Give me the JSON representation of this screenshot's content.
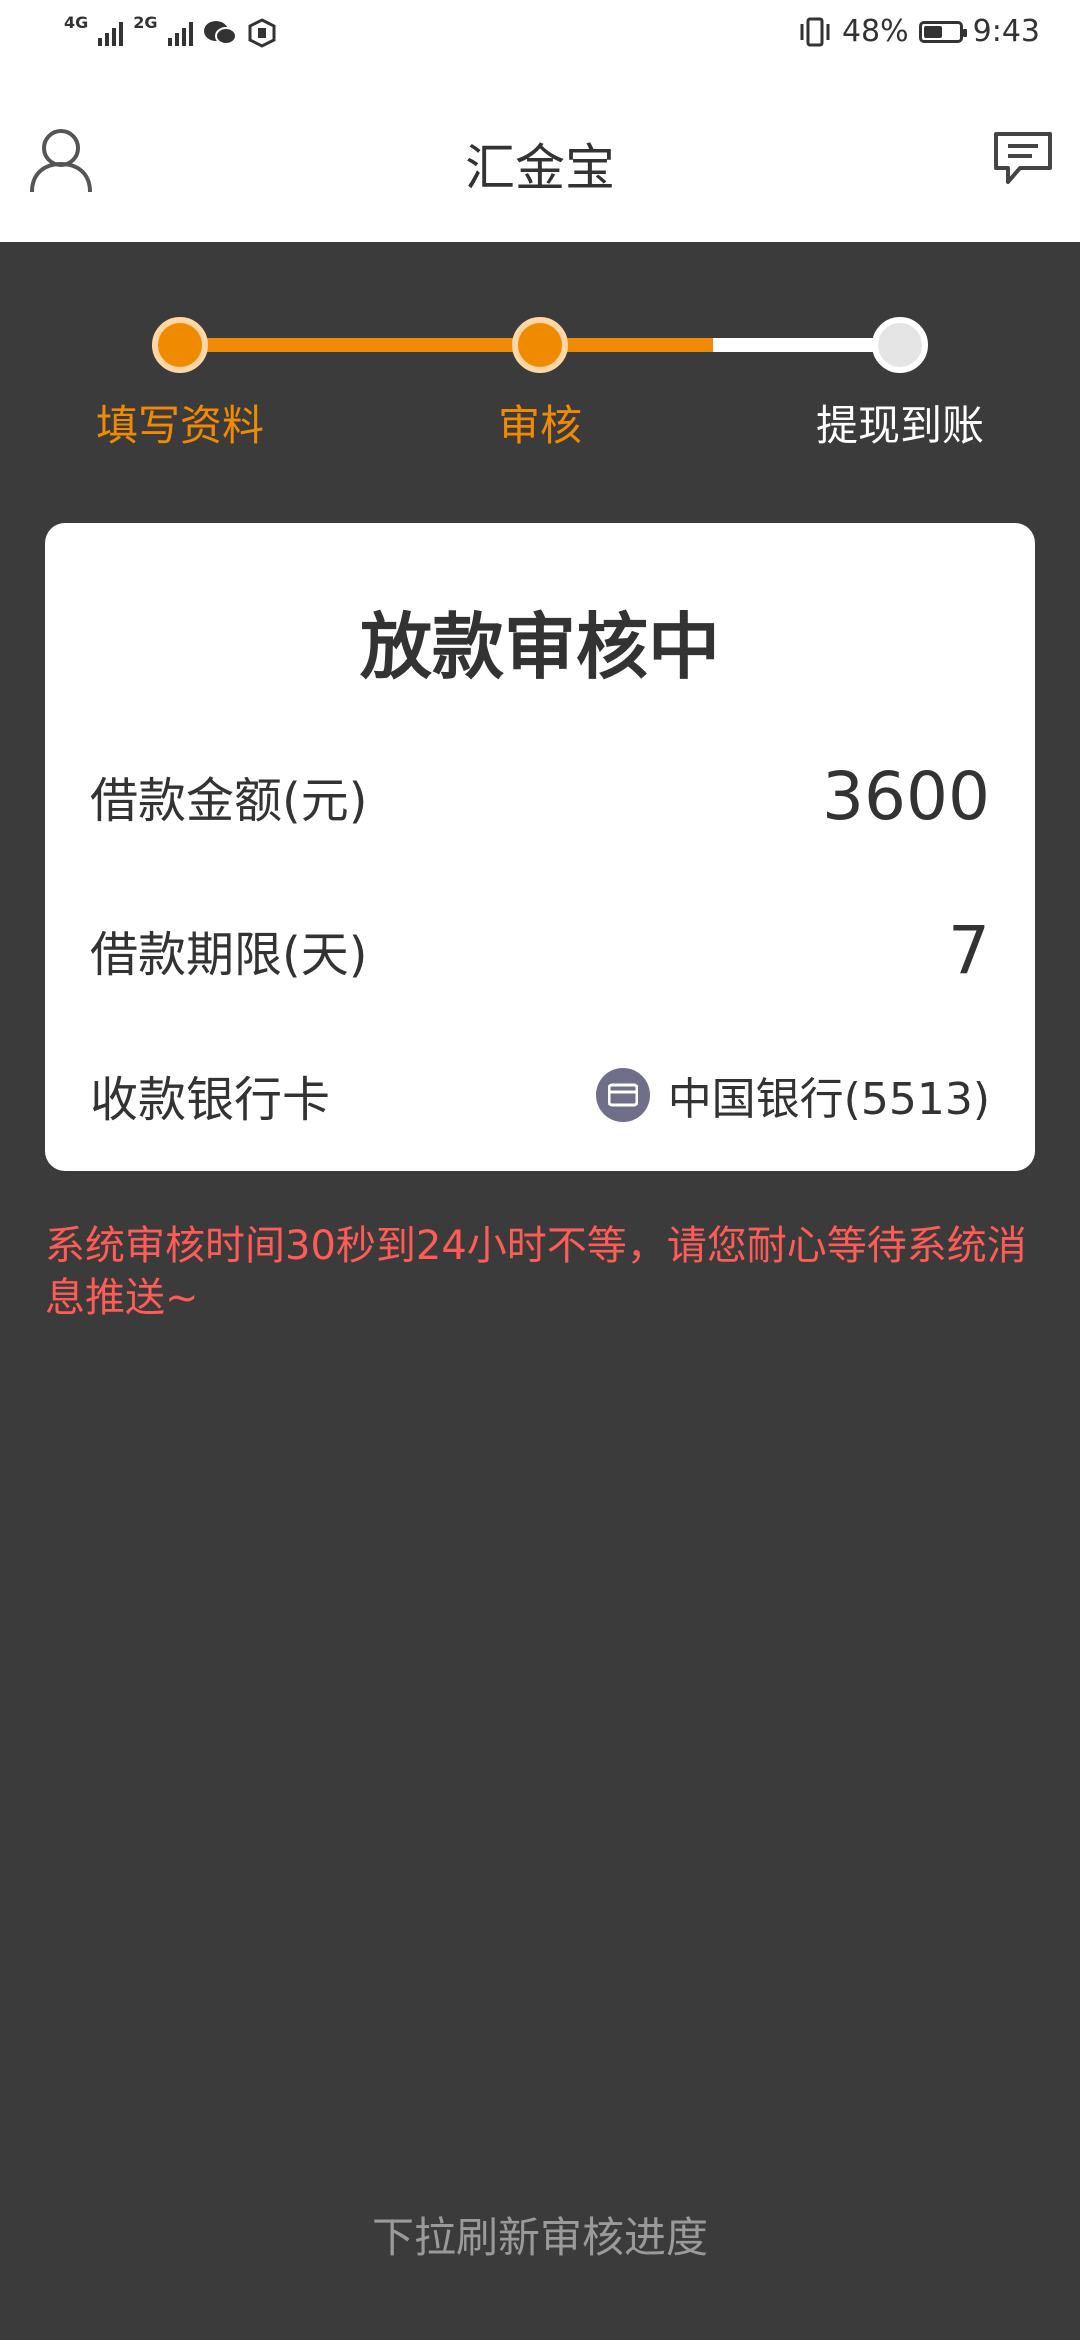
{
  "status_bar": {
    "net1": "4G",
    "net2": "2G",
    "battery_percent": "48%",
    "battery_level": 0.48,
    "time": "9:43",
    "icons": [
      "signal-icon",
      "signal-icon",
      "wechat-icon",
      "shield-icon",
      "vibrate-icon",
      "battery-icon"
    ]
  },
  "app_bar": {
    "title": "汇金宝",
    "left_icon": "user-icon",
    "right_icon": "message-icon"
  },
  "stepper": {
    "progress_fraction": 0.74,
    "steps": [
      {
        "label": "填写资料",
        "state": "done"
      },
      {
        "label": "审核",
        "state": "done"
      },
      {
        "label": "提现到账",
        "state": "todo"
      }
    ],
    "colors": {
      "accent": "#f08a00",
      "inactive_text": "#ffffff"
    }
  },
  "card": {
    "title": "放款审核中",
    "rows": [
      {
        "label": "借款金额(元)",
        "value": "3600"
      },
      {
        "label": "借款期限(天)",
        "value": "7"
      },
      {
        "label": "收款银行卡",
        "value": "中国银行(5513)",
        "icon": "bank-card-icon"
      }
    ]
  },
  "notice": {
    "text": "系统审核时间30秒到24小时不等，请您耐心等待系统消息推送~",
    "color": "#ff5b57"
  },
  "footer": {
    "hint": "下拉刷新审核进度"
  }
}
